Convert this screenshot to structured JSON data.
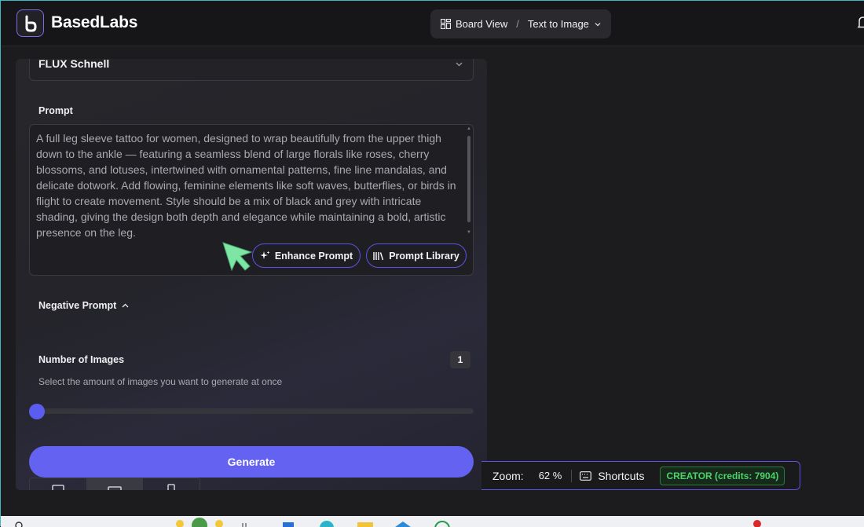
{
  "header": {
    "brand": "BasedLabs",
    "view_switch": {
      "board_label": "Board View",
      "separator": "/",
      "mode_label": "Text to Image"
    }
  },
  "panel": {
    "model": "FLUX Schnell",
    "prompt": {
      "label": "Prompt",
      "value": "A full leg sleeve tattoo for women, designed to wrap beautifully from the upper thigh down to the ankle — featuring a seamless blend of large florals like roses, cherry blossoms, and lotuses, intertwined with ornamental patterns, fine line mandalas, and delicate dotwork. Add flowing, feminine elements like soft waves, butterflies, or birds in flight to create movement. Style should be a mix of black and grey with intricate shading, giving the design both depth and elegance while maintaining a bold, artistic presence on the leg.",
      "enhance_label": "Enhance Prompt",
      "library_label": "Prompt Library"
    },
    "negative_prompt_label": "Negative Prompt",
    "number_of_images": {
      "label": "Number of Images",
      "value": "1",
      "helper": "Select the amount of images you want to generate at once",
      "slider_fraction": 0.0
    },
    "generate_label": "Generate"
  },
  "status_bar": {
    "zoom_label": "Zoom:",
    "zoom_value": "62 %",
    "shortcuts_label": "Shortcuts",
    "credits_label": "CREATOR (credits: 7904)"
  },
  "colors": {
    "accent": "#6462f0",
    "accent_border": "#5b52e6",
    "credits_green": "#4cd36a",
    "cursor_green": "#7ee6a4"
  },
  "icons": [
    "basedlabs-logo-icon",
    "grid-icon",
    "chevron-down-icon",
    "bell-icon",
    "sparkle-icon",
    "library-icon",
    "chevron-up-icon",
    "cursor-icon",
    "keyboard-icon"
  ]
}
